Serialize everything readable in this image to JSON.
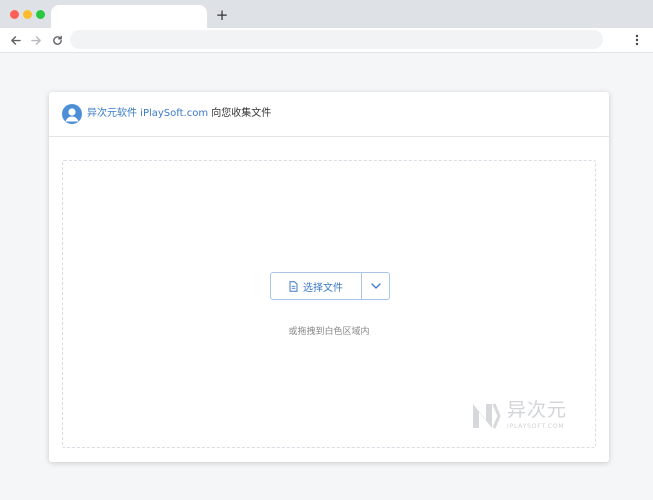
{
  "browser": {
    "new_tab_label": "+",
    "tab_title": "",
    "address": ""
  },
  "card": {
    "owner": "异次元软件 iPlaySoft.com",
    "suffix": " 向您收集文件",
    "select_button_label": "选择文件",
    "drag_hint": "或拖拽到白色区域内"
  },
  "watermark": {
    "title": "异次元",
    "subtitle": "IPLAYSOFT.COM"
  },
  "colors": {
    "accent": "#3a79c8",
    "avatar": "#4d8fd6",
    "tab_strip": "#dee1e6",
    "traffic_red": "#ff5f57",
    "traffic_yellow": "#febc2e",
    "traffic_green": "#28c840"
  },
  "icons": {
    "back": "arrow-left-icon",
    "forward": "arrow-right-icon",
    "reload": "reload-icon",
    "menu": "kebab-menu-icon",
    "file": "file-icon",
    "caret": "chevron-down-icon",
    "avatar": "user-avatar-icon"
  }
}
